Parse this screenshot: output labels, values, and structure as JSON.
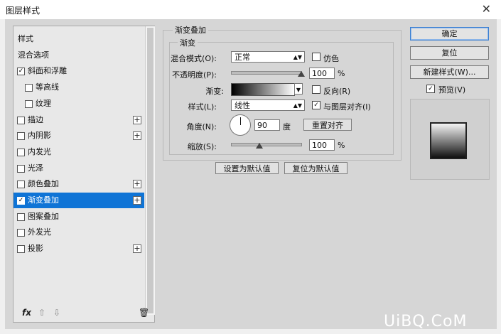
{
  "window": {
    "title": "图层样式",
    "close_symbol": "✕"
  },
  "sidebar": {
    "items": [
      {
        "label": "样式",
        "checkbox": false,
        "checked": false,
        "indent": false,
        "plus": false,
        "selected": false
      },
      {
        "label": "混合选项",
        "checkbox": false,
        "checked": false,
        "indent": false,
        "plus": false,
        "selected": false
      },
      {
        "label": "斜面和浮雕",
        "checkbox": true,
        "checked": true,
        "indent": false,
        "plus": false,
        "selected": false
      },
      {
        "label": "等高线",
        "checkbox": true,
        "checked": false,
        "indent": true,
        "plus": false,
        "selected": false
      },
      {
        "label": "纹理",
        "checkbox": true,
        "checked": false,
        "indent": true,
        "plus": false,
        "selected": false
      },
      {
        "label": "描边",
        "checkbox": true,
        "checked": false,
        "indent": false,
        "plus": true,
        "selected": false
      },
      {
        "label": "内阴影",
        "checkbox": true,
        "checked": false,
        "indent": false,
        "plus": true,
        "selected": false
      },
      {
        "label": "内发光",
        "checkbox": true,
        "checked": false,
        "indent": false,
        "plus": false,
        "selected": false
      },
      {
        "label": "光泽",
        "checkbox": true,
        "checked": false,
        "indent": false,
        "plus": false,
        "selected": false
      },
      {
        "label": "颜色叠加",
        "checkbox": true,
        "checked": false,
        "indent": false,
        "plus": true,
        "selected": false
      },
      {
        "label": "渐变叠加",
        "checkbox": true,
        "checked": true,
        "indent": false,
        "plus": true,
        "selected": true
      },
      {
        "label": "图案叠加",
        "checkbox": true,
        "checked": false,
        "indent": false,
        "plus": false,
        "selected": false
      },
      {
        "label": "外发光",
        "checkbox": true,
        "checked": false,
        "indent": false,
        "plus": false,
        "selected": false
      },
      {
        "label": "投影",
        "checkbox": true,
        "checked": false,
        "indent": false,
        "plus": true,
        "selected": false
      }
    ],
    "footer": {
      "fx": "fx",
      "up": "⇧",
      "down": "⇩",
      "trash": "🗑"
    }
  },
  "panel": {
    "group_title": "渐变叠加",
    "inner_title": "渐变",
    "blend_mode": {
      "label": "混合模式(O):",
      "value": "正常"
    },
    "dither": {
      "label": "仿色",
      "checked": false
    },
    "opacity": {
      "label": "不透明度(P):",
      "value": "100",
      "unit": "%",
      "level": 1.0
    },
    "gradient": {
      "label": "渐变:"
    },
    "reverse": {
      "label": "反向(R)",
      "checked": false
    },
    "style": {
      "label": "样式(L):",
      "value": "线性"
    },
    "align": {
      "label": "与图层对齐(I)",
      "checked": true
    },
    "angle": {
      "label": "角度(N):",
      "value": "90",
      "unit": "度"
    },
    "reset_align": "重置对齐",
    "scale": {
      "label": "缩放(S):",
      "value": "100",
      "unit": "%",
      "level": 0.4
    },
    "set_default": "设置为默认值",
    "reset_default": "复位为默认值"
  },
  "right": {
    "ok": "确定",
    "reset": "复位",
    "new_style": "新建样式(W)...",
    "preview": {
      "label": "预览(V)",
      "checked": true
    }
  },
  "watermark": "UiBQ.CoM",
  "check_glyph": "✓",
  "plus_glyph": "+"
}
